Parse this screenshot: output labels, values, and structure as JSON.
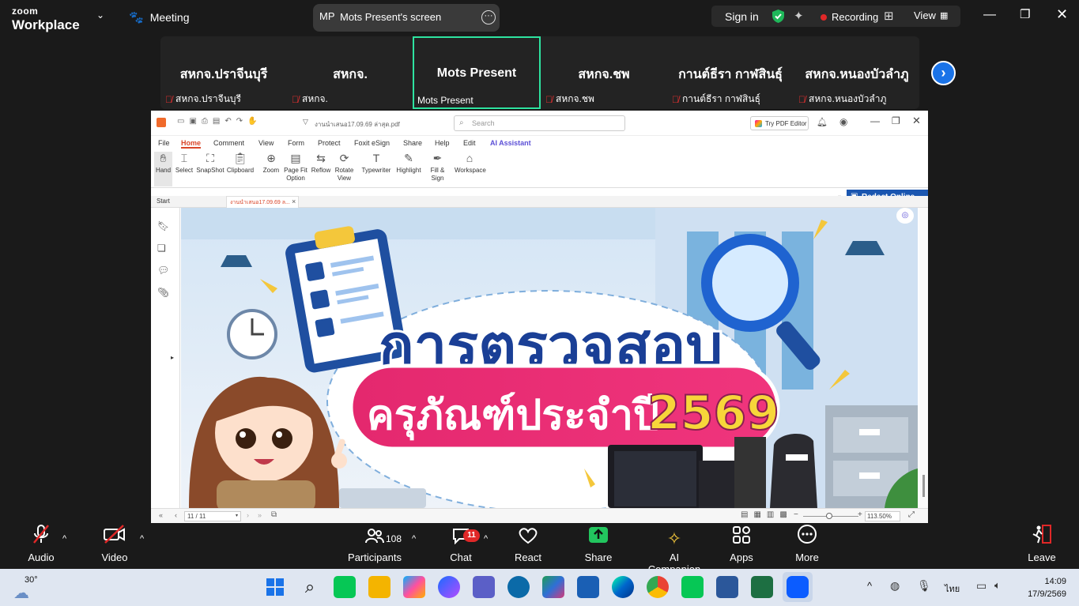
{
  "topbar": {
    "logo_top": "zoom",
    "logo_bottom": "Workplace",
    "meeting_label": "Meeting",
    "share_avatar": "MP",
    "share_title": "Mots Present's screen",
    "sign_in": "Sign in",
    "recording": "Recording",
    "view": "View"
  },
  "gallery": {
    "tiles": [
      {
        "name": "สหกจ.ปราจีนบุรี",
        "label": "สหกจ.ปราจีนบุรี",
        "muted": true
      },
      {
        "name": "สหกจ.",
        "label": "สหกจ.",
        "muted": true
      },
      {
        "name": "Mots Present",
        "label": "Mots Present",
        "muted": false
      },
      {
        "name": "สหกจ.ชพ",
        "label": "สหกจ.ชพ",
        "muted": true
      },
      {
        "name": "กานต์ธีรา กาฬสินธุ์",
        "label": "กานต์ธีรา กาฬสินธุ์",
        "muted": true
      },
      {
        "name": "สหกจ.หนองบัวลำภู",
        "label": "สหกจ.หนองบัวลำภู",
        "muted": true
      }
    ]
  },
  "foxit": {
    "filename": "งานนำเสนอ17.09.69 ล่าสุด.pdf",
    "search_placeholder": "Search",
    "try_editor": "Try PDF Editor",
    "menus": [
      "File",
      "Home",
      "Comment",
      "View",
      "Form",
      "Protect",
      "Foxit eSign",
      "Share",
      "Help",
      "Edit",
      "AI Assistant"
    ],
    "tools": {
      "hand": "Hand",
      "select": "Select",
      "snapshot": "SnapShot",
      "clipboard": "Clipboard",
      "zoom": "Zoom",
      "pagefit": "Page Fit Option",
      "reflow": "Reflow",
      "rotate": "Rotate View",
      "typewriter": "Typewriter",
      "highlight": "Highlight",
      "fillsign": "Fill & Sign",
      "workspace": "Workspace"
    },
    "tab_start": "Start",
    "tab_doc": "งานนำเสนอ17.09.69 ล...",
    "redact": "Redact Online",
    "page_indicator": "11 / 11",
    "zoom_level": "113.50%",
    "slide_title": "การตรวจสอบ",
    "slide_subtitle": "ครุภัณฑ์ประจำปี",
    "slide_year": "2569"
  },
  "controls": {
    "audio": "Audio",
    "video": "Video",
    "participants_count": "108",
    "participants": "Participants",
    "chat_badge": "11",
    "chat": "Chat",
    "react": "React",
    "share": "Share",
    "ai": "AI Companion",
    "apps": "Apps",
    "more": "More",
    "leave": "Leave"
  },
  "taskbar": {
    "temperature": "30°",
    "language": "ไทย",
    "time": "14:09",
    "date": "17/9/2569"
  }
}
